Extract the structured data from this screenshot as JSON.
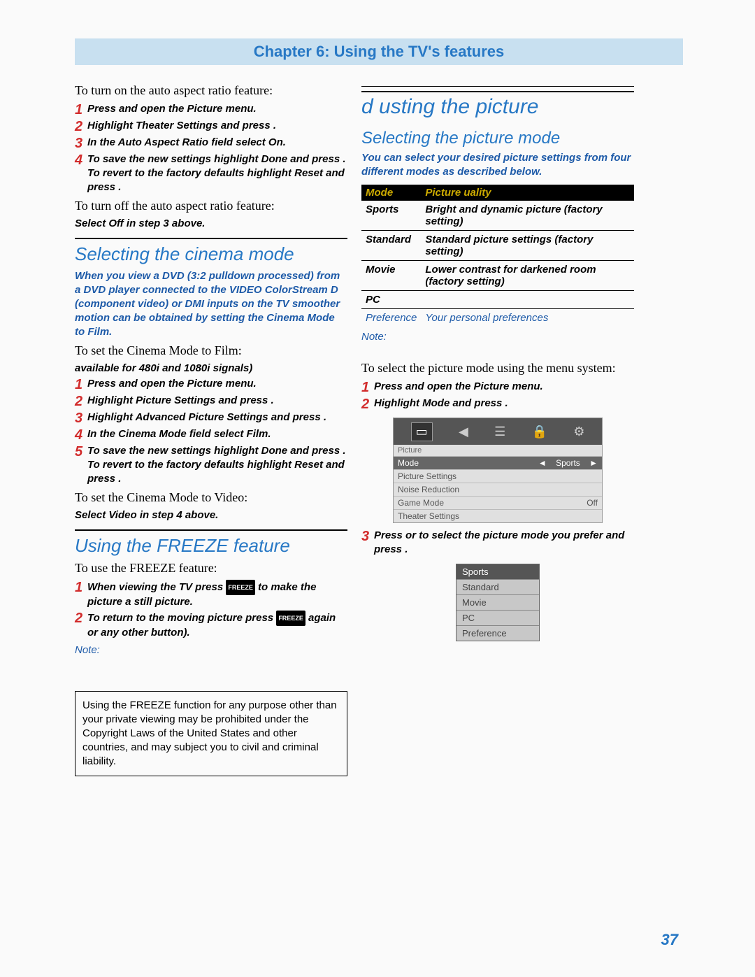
{
  "chapter": "Chapter 6: Using the TV's features",
  "left": {
    "auto_on_intro": "To turn on the auto aspect ratio feature:",
    "auto_on_steps": [
      "Press  and open the Picture menu.",
      "Highlight Theater Settings and press .",
      "In the Auto Aspect Ratio field  select On.",
      "To save the new settings  highlight Done and press . To revert to the factory defaults  highlight Reset and press ."
    ],
    "auto_off_intro": "To turn off the auto aspect ratio feature:",
    "auto_off_instr": "Select Off in step 3 above.",
    "cinema_h": "Selecting the cinema mode",
    "cinema_intro": "When you view a DVD (3:2 pulldown processed) from a DVD player connected to the VIDEO  ColorStream D (component video)  or DMI inputs on the TV smoother motion can be obtained by setting the Cinema Mode to Film.",
    "cinema_set_film": "To set the Cinema Mode to Film:",
    "cinema_avail": "available for 480i and 1080i signals)",
    "cinema_steps": [
      "Press  and open the Picture menu.",
      "Highlight Picture Settings and press .",
      "Highlight Advanced Picture Settings and press .",
      "In the Cinema Mode field  select Film.",
      "To save the new settings  highlight Done and press . To revert to the factory defaults  highlight Reset and press ."
    ],
    "cinema_video_intro": "To set the Cinema Mode to Video:",
    "cinema_video_instr": "Select Video in step 4 above.",
    "freeze_h": "Using the FREEZE feature",
    "freeze_intro": "To use the FREEZE feature:",
    "freeze_steps": [
      "When viewing the TV  press  to make the picture a still picture.",
      "To return to the moving picture  press  again or any other button)."
    ],
    "freeze_note": "Note:",
    "disclaimer": "Using the FREEZE function for any purpose other than your private viewing may be prohibited under the Copyright Laws of the United States and other countries, and may subject you to civil and criminal liability."
  },
  "right": {
    "adjust_h": "d usting the picture",
    "select_h": "Selecting the picture mode",
    "select_intro": "You can select your desired picture settings from four different modes  as described below.",
    "table_headers": [
      "Mode",
      "Picture  uality"
    ],
    "table_rows": [
      [
        "Sports",
        "Bright and dynamic picture (factory setting)"
      ],
      [
        "Standard",
        "Standard picture settings (factory setting)"
      ],
      [
        "Movie",
        "Lower contrast for darkened room (factory setting)"
      ],
      [
        "PC",
        ""
      ]
    ],
    "pref_row": [
      "Preference",
      "Your personal preferences"
    ],
    "note": "Note:",
    "select_body": "To select the picture mode using the menu system:",
    "select_steps": [
      "Press  and open the Picture menu.",
      "Highlight Mode and press ."
    ],
    "step3": "Press   or   to select the picture mode you prefer and press .",
    "osd": {
      "title": "Picture",
      "rows": [
        {
          "label": "Mode",
          "value": "Sports",
          "sel": true
        },
        {
          "label": "Picture Settings",
          "value": ""
        },
        {
          "label": "Noise Reduction",
          "value": ""
        },
        {
          "label": "Game Mode",
          "value": "Off"
        },
        {
          "label": "Theater Settings",
          "value": ""
        }
      ]
    },
    "popup": [
      "Sports",
      "Standard",
      "Movie",
      "PC",
      "Preference"
    ]
  },
  "page_num": "37"
}
